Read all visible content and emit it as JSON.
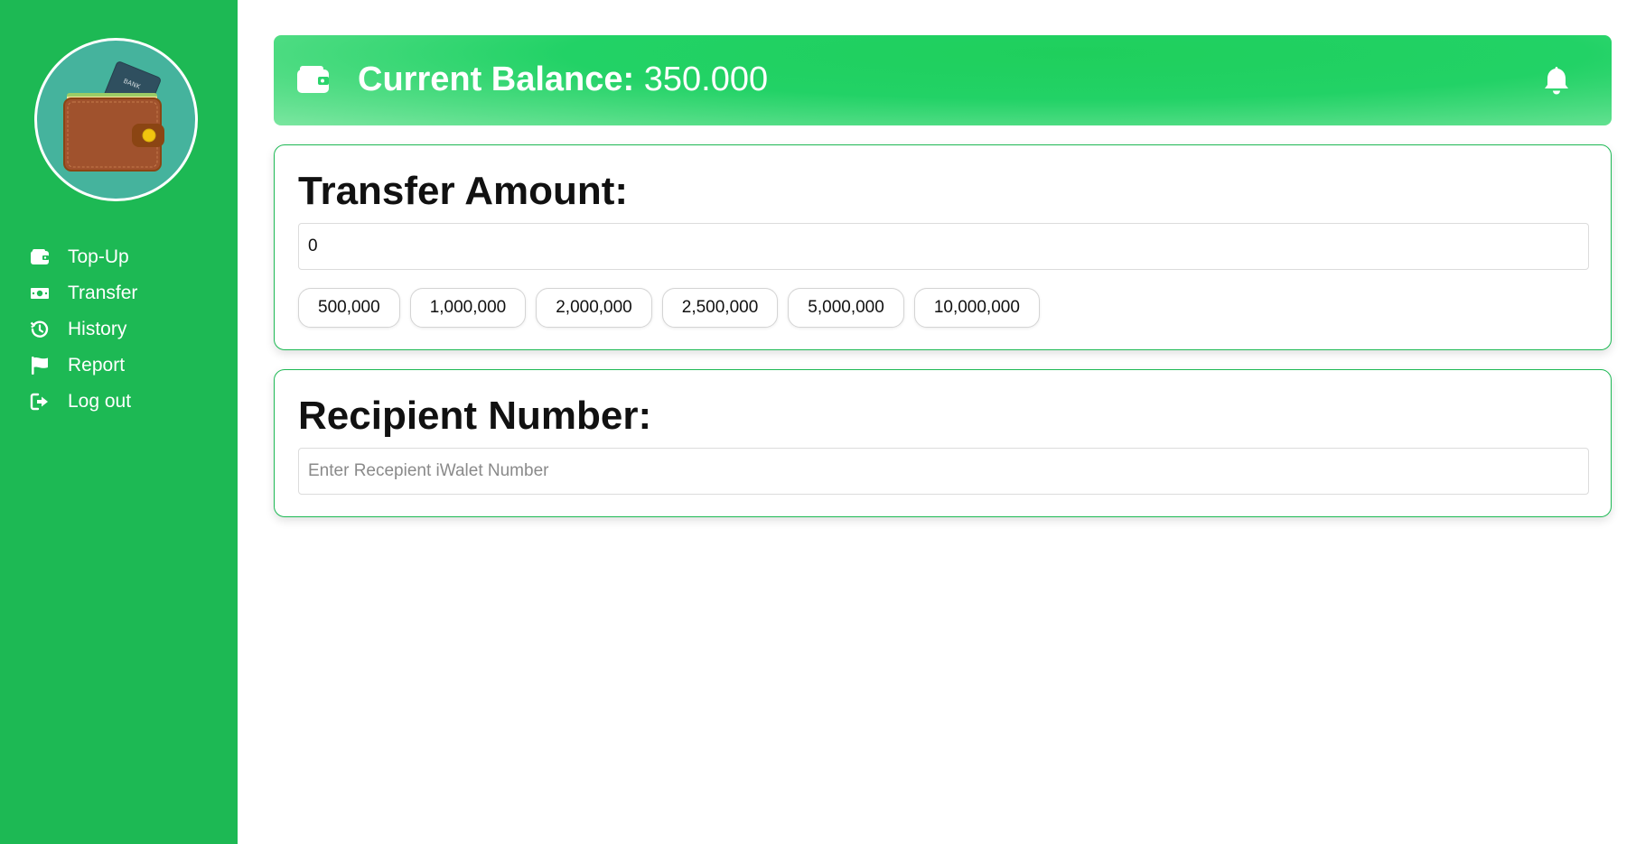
{
  "sidebar": {
    "logo_icon": "wallet-with-card-logo",
    "logo_card_text": "BANK",
    "items": [
      {
        "label": "Top-Up",
        "icon": "wallet-icon"
      },
      {
        "label": "Transfer",
        "icon": "money-bill-icon"
      },
      {
        "label": "History",
        "icon": "history-icon"
      },
      {
        "label": "Report",
        "icon": "flag-icon"
      },
      {
        "label": "Log out",
        "icon": "logout-icon"
      }
    ]
  },
  "header": {
    "balance_label": "Current Balance:",
    "balance_value": "350.000",
    "wallet_icon": "wallet-icon",
    "bell_icon": "bell-icon"
  },
  "transfer": {
    "title": "Transfer Amount:",
    "amount_value": "0",
    "presets": [
      "500,000",
      "1,000,000",
      "2,000,000",
      "2,500,000",
      "5,000,000",
      "10,000,000"
    ]
  },
  "recipient": {
    "title": "Recipient Number:",
    "placeholder": "Enter Recepient iWalet Number"
  },
  "colors": {
    "sidebar": "#1db954",
    "accent": "#22d266",
    "card_border": "#1db954",
    "logo_bg": "#45b39d"
  }
}
